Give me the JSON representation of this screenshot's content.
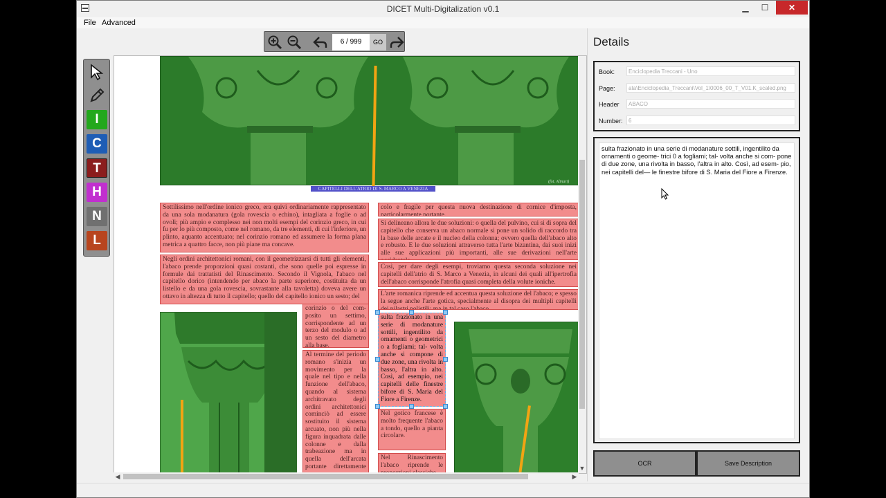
{
  "window": {
    "title": "DICET Multi-Digitalization v0.1",
    "minimize": "▁",
    "maximize": "☐",
    "close": "✕"
  },
  "menu": {
    "file": "File",
    "advanced": "Advanced"
  },
  "toolbar": {
    "page_indicator": "6 / 999",
    "go_label": "GO"
  },
  "tools": {
    "select": "select-arrow-icon",
    "pen": "pencil-icon",
    "image": "I",
    "caption": "C",
    "text": "T",
    "header": "H",
    "number": "N",
    "line": "L"
  },
  "tool_colors": {
    "image": "#23a81c",
    "caption": "#1e5db5",
    "text": "#8b1d1d",
    "header": "#c12fcf",
    "number": "#707070",
    "line": "#b8451e"
  },
  "document": {
    "caption": "CAPITELLI DELL'ATRIO DI S. MARCO A VENEZIA",
    "photo_credit": "(fot. Alinari)",
    "col1_p1": "Sottilissimo nell'ordine ionico greco, era quivi ordinariamente rappresentato da una sola modanatura (gola rovescia o echino), intagliata a foglie o ad ovoli; più ampio e complesso nei non molti esempi del corinzio greco, in cui fu per lo più composto, come nel romano, da tre elementi, di cui l'inferiore, un plinto, aquanto accentuato; nel corinzio romano ed assumere la forma plana metrica a quattro facce, non più piane ma concave.",
    "col1_p2": "Negli ordini architettonici romani, con il geometrizzarsi di tutti gli elementi, l'abaco prende proporzioni quasi costanti, che sono quelle poi espresse in formule dai trattatisti del Rinascimento. Secondo il Vignola, l'abaco nel capitello dorico (intendendo per abaco la parte superiore, costituita da un listello e da una gola rovescia, sovrastante alla tavoletta) doveva avere un ottavo in altezza di tutto il capitello; quello del capitello ionico un sesto; del",
    "col2_p1": "corinzio o del com- posito un settimo, corrispondente ad un terzo del modulo o ad un sesto del diametro alla base.",
    "col2_p2": "Al termine del periodo romano s'inizia un movimento per la quale nel tipo e nella funzione dell'abaco, quando al sistema architravato degli ordini architettonici cominciò ad essere sostituito il sistema arcuato, non più nella figura inquadrata dalle colonne e dalla trabeazione ma in quella dell'arcata portante direttamente su",
    "col3_p1": "colo e fragile per questa nuova destinazione di cornice d'imposta, particolarmente portante.",
    "col3_p2": "Si delineano allora le due soluzioni: o quella del pulvino, cui si di sopra del capitello che conserva un abaco normale si pone un solido di raccordo tra la base delle arcate e il nucleo della colonna; ovvero quella dell'abaco alto e robusto. E le due soluzioni attraverso tutta l'arte bizantina, dai suoi inizi alle sue applicazioni più importanti, alle sue derivazioni nell'arte occidentale.",
    "col3_p3": "Così, per dare degli esempi, troviamo questa seconda soluzione nei capitelli dell'atrio di S. Marco a Venezia, in alcuni dei quali all'ipertrofia dell'abaco corrisponde l'atrofia quasi completa della volute ioniche.",
    "col3_p4": "L'arte romanica riprende ed accentua questa soluzione del l'abaco; e spesso la segue anche l'arte gotica, specialmente al disopra dei multipli capitelli dei pilastri polistili; ma in tal caso l'abaco",
    "col3_sel": "sulta frazionato in una serie di modanature sottili, ingentilito da ornamenti o geometrici o a fogliami; tal- volta anche si compone di due zone, una rivolta in basso, l'altra in alto. Così, ad esempio, nei capitelli delle finestre bifore di S. Maria del Fiore a Firenze.",
    "col3_p5": "Nel gotico francese è molto frequente l'abaco a tondo, quello a pianta circolare.",
    "col3_p6": "Nel Rinascimento l'abaco riprende le proporzioni classiche"
  },
  "details": {
    "title": "Details",
    "book_label": "Book:",
    "book_value": "Enciclopedia Treccani - Uno",
    "page_label": "Page:",
    "page_value": "ata\\Enciclopedia_Treccani\\Vol_1\\0006_00_T_V01.K_scaled.png",
    "header_label": "Header",
    "header_value": "ABACO",
    "number_label": "Number:",
    "number_value": "6",
    "description": "sulta frazionato in una serie di modanature sottili, ingentilito da ornamenti o geome- trici 0 a fogliami; tal- volta anche si com- pone di due zone, una rivolta in basso, l'altra in alto. Così, ad esem- pio, nei capitelli del— le finestre bifore di S. Maria del Fiore a Firenze."
  },
  "buttons": {
    "ocr": "OCR",
    "save_description": "Save Description"
  }
}
